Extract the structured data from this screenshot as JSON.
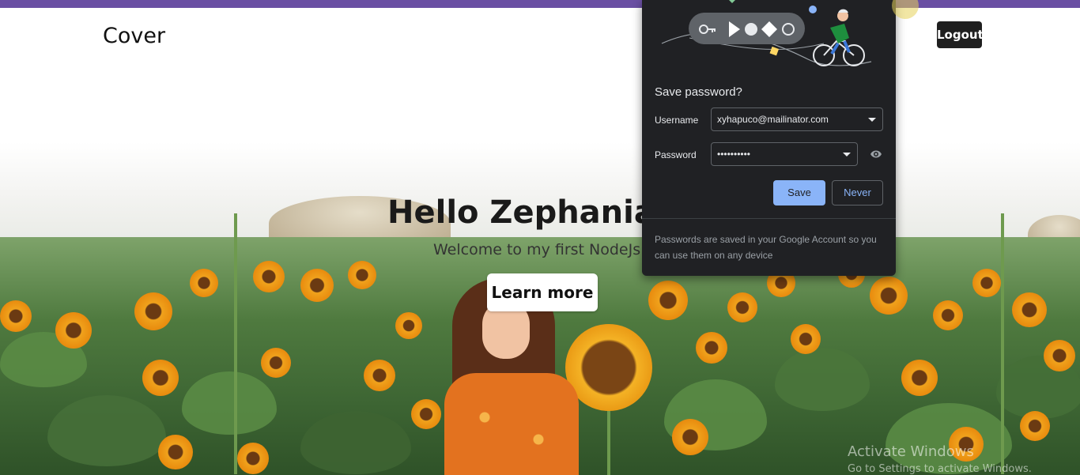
{
  "nav": {
    "title": "Cover",
    "logout_label": "Logout"
  },
  "hero": {
    "title": "Hello Zephania Ty",
    "subtitle": "Welcome to my first NodeJs Ap",
    "learn_more_label": "Learn more"
  },
  "password_popup": {
    "title": "Save password?",
    "username_label": "Username",
    "username_value": "xyhapuco@mailinator.com",
    "password_label": "Password",
    "password_value": "••••••••••",
    "save_label": "Save",
    "never_label": "Never",
    "footer_note": "Passwords are saved in your Google Account so you can use them on any device",
    "accent_color": "#8ab4f8",
    "background_color": "#202124"
  },
  "watermark": {
    "line1": "Activate Windows",
    "line2": "Go to Settings to activate Windows."
  },
  "colors": {
    "topbar": "#6a4fa3",
    "logout_bg": "#1f1f1f"
  }
}
